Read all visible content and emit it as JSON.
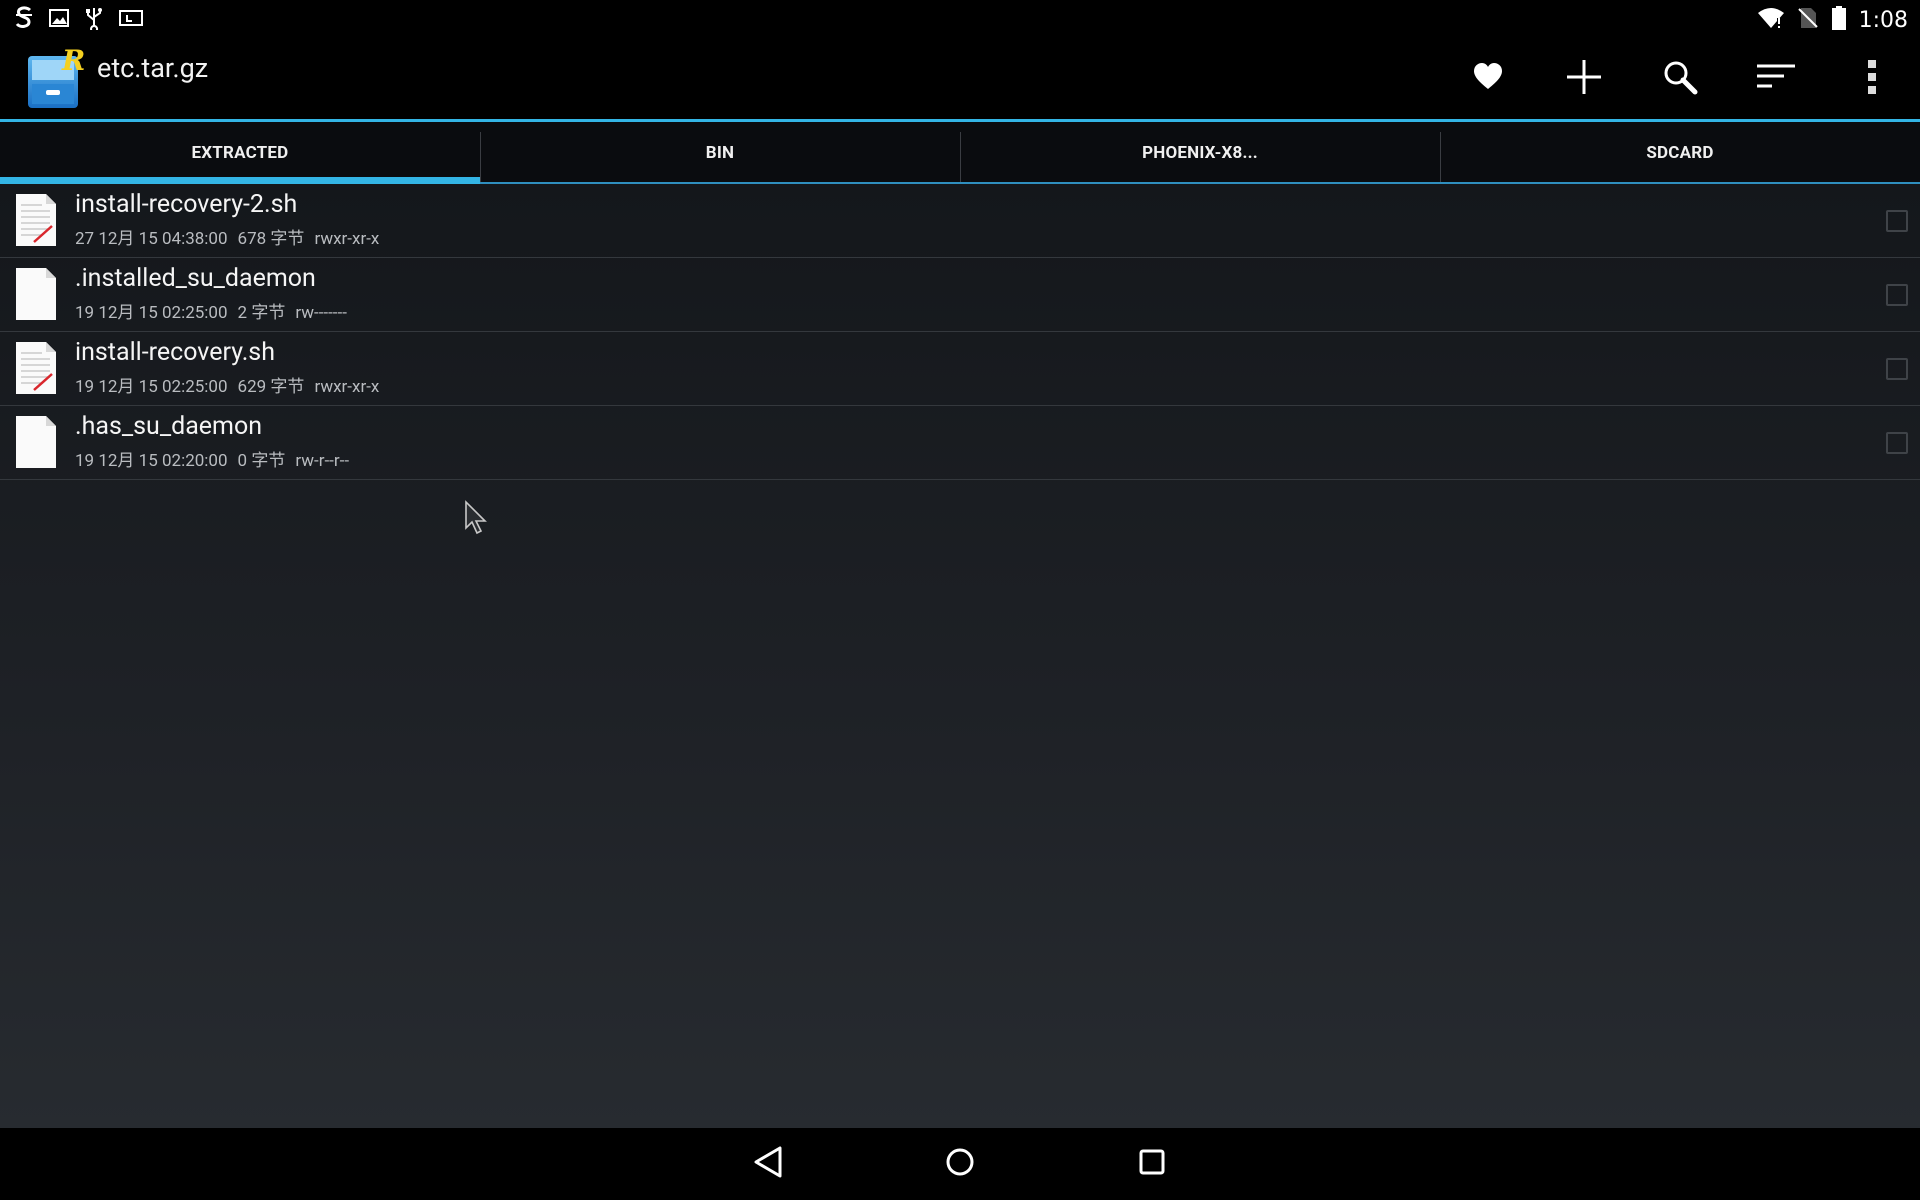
{
  "status_bar": {
    "time": "1:08",
    "left_icons": [
      "s-app-icon",
      "image-icon",
      "usb-icon",
      "sd-card-icon"
    ],
    "right_icons": [
      "wifi-icon",
      "no-sim-icon",
      "battery-icon"
    ]
  },
  "action_bar": {
    "title": "etc.tar.gz",
    "app_icon": "root-explorer-icon",
    "actions": [
      {
        "name": "favorite",
        "icon": "heart-icon"
      },
      {
        "name": "new",
        "icon": "plus-icon"
      },
      {
        "name": "search",
        "icon": "search-icon"
      },
      {
        "name": "sort",
        "icon": "sort-icon"
      },
      {
        "name": "overflow",
        "icon": "more-vertical-icon"
      }
    ]
  },
  "tabs": [
    {
      "label": "EXTRACTED",
      "active": true
    },
    {
      "label": "BIN",
      "active": false
    },
    {
      "label": "PHOENIX-X8...",
      "active": false
    },
    {
      "label": "SDCARD",
      "active": false
    }
  ],
  "files": [
    {
      "name": "install-recovery-2.sh",
      "date": "27 12月 15 04:38:00",
      "size": "678 字节",
      "perms": "rwxr-xr-x",
      "type": "script"
    },
    {
      "name": ".installed_su_daemon",
      "date": "19 12月 15 02:25:00",
      "size": "2 字节",
      "perms": "rw-------",
      "type": "blank"
    },
    {
      "name": "install-recovery.sh",
      "date": "19 12月 15 02:25:00",
      "size": "629 字节",
      "perms": "rwxr-xr-x",
      "type": "script"
    },
    {
      "name": ".has_su_daemon",
      "date": "19 12月 15 02:20:00",
      "size": "0 字节",
      "perms": "rw-r--r--",
      "type": "blank"
    }
  ],
  "nav_bar": {
    "buttons": [
      {
        "name": "back",
        "icon": "back-triangle-icon"
      },
      {
        "name": "home",
        "icon": "home-circle-icon"
      },
      {
        "name": "recents",
        "icon": "recents-square-icon"
      }
    ]
  },
  "colors": {
    "accent": "#33b5e5",
    "background_top": "#14171b",
    "background_bottom": "#272b30",
    "divider": "#34383d"
  }
}
